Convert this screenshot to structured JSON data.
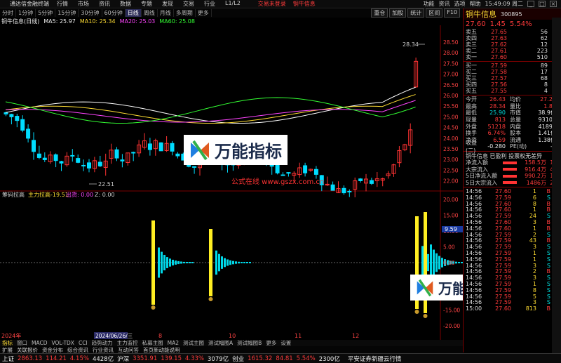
{
  "titlebar": {
    "app": "通达信金融终端",
    "menu": [
      "行情",
      "市场",
      "资讯",
      "数据",
      "专题",
      "发现",
      "交易",
      "行业",
      "L1/L2"
    ],
    "center_left": "交易未登录",
    "center_right": "铜牛信息",
    "right_menu": [
      "功能",
      "资讯",
      "选项",
      "帮助"
    ],
    "clock": "15:49:09 周二"
  },
  "toolbar": {
    "periods": [
      "分时",
      "1分钟",
      "5分钟",
      "15分钟",
      "30分钟",
      "60分钟",
      "日线",
      "周线",
      "月线",
      "多周期",
      "更多"
    ],
    "active": "日线",
    "tools": [
      "重仓",
      "加股",
      "统计",
      "区间",
      "F10"
    ]
  },
  "ma": {
    "title": "铜牛信息(日线)",
    "ma5": "MA5: 25.97",
    "ma10": "MA10: 25.34",
    "ma20": "MA20: 25.03",
    "ma60": "MA60: 25.08"
  },
  "chart": {
    "high_label": "28.34",
    "low_label": "22.51",
    "y_labels": [
      "28.50",
      "28.00",
      "27.50",
      "27.00",
      "26.50",
      "26.00",
      "25.50",
      "25.00",
      "24.50",
      "24.00",
      "23.50",
      "23.00",
      "22.50",
      "22.00"
    ]
  },
  "indicator": {
    "title": "筹码拉高",
    "name": "主力拉高",
    "value": "-19.51",
    "chuhuo": "出货: 0.00",
    "z": "Z: 0.00",
    "y_labels": [
      "20.00",
      "15.00",
      "10.00",
      "5.00",
      "0.00",
      "-5.00",
      "-10.00",
      "-15.00",
      "-20.00"
    ],
    "mark": "9.59"
  },
  "axis": {
    "year": "2024年",
    "date": "2024/06/26/三",
    "marks": [
      "8",
      "10",
      "11",
      "12"
    ]
  },
  "watermark": {
    "text": "万能指标",
    "url": "公式在线 www.gszx.com.cn"
  },
  "quote": {
    "name": "铜牛信息",
    "price": "27.60",
    "change": "1.45",
    "pct": "5.54%",
    "code": "300895",
    "asks": [
      [
        "卖五",
        "27.65",
        "56"
      ],
      [
        "卖四",
        "27.63",
        "62"
      ],
      [
        "卖三",
        "27.62",
        "12"
      ],
      [
        "卖二",
        "27.61",
        "223"
      ],
      [
        "卖一",
        "27.60",
        "510"
      ]
    ],
    "bids": [
      [
        "买一",
        "27.59",
        "89"
      ],
      [
        "买二",
        "27.58",
        "17"
      ],
      [
        "买三",
        "27.57",
        "68"
      ],
      [
        "买四",
        "27.56",
        "8"
      ],
      [
        "买五",
        "27.55",
        "4"
      ]
    ],
    "stats": [
      [
        "今开",
        "26.43",
        "均价",
        "27.28"
      ],
      [
        "最高",
        "28.34",
        "量比",
        "1.88"
      ],
      [
        "最低",
        "25.90",
        "市值",
        "38.9亿"
      ],
      [
        "现量",
        "813",
        "总量",
        "93109"
      ],
      [
        "外盘",
        "51218",
        "内盘",
        "41891"
      ],
      [
        "换手",
        "6.74%",
        "股本",
        "1.41亿"
      ],
      [
        "净资",
        "6.59",
        "流通",
        "1.38亿"
      ],
      [
        "收益(二)",
        "-0.280",
        "PE(动)",
        "—"
      ]
    ],
    "tag": "铜牛信息 已盈利 投票权无差异",
    "flows": [
      [
        "净流入额",
        "158.5万",
        "1%"
      ],
      [
        "大宗流入",
        "916.4万",
        "4%"
      ],
      [
        "5日净流入额",
        "990.2万",
        "1%"
      ],
      [
        "5日大宗流入",
        "1486万",
        "2%"
      ]
    ],
    "ticks": [
      [
        "14:56",
        "27.60",
        "1",
        "B"
      ],
      [
        "14:56",
        "27.59",
        "6",
        "S"
      ],
      [
        "14:56",
        "27.60",
        "8",
        "B"
      ],
      [
        "14:56",
        "27.60",
        "1",
        "B"
      ],
      [
        "14:56",
        "27.59",
        "24",
        "S"
      ],
      [
        "14:56",
        "27.60",
        "3",
        "B"
      ],
      [
        "14:56",
        "27.60",
        "1",
        "B"
      ],
      [
        "14:56",
        "27.59",
        "2",
        "S"
      ],
      [
        "14:56",
        "27.59",
        "43",
        "B"
      ],
      [
        "14:56",
        "27.59",
        "3",
        "S"
      ],
      [
        "14:56",
        "27.59",
        "1",
        "S"
      ],
      [
        "14:56",
        "27.59",
        "1",
        "S"
      ],
      [
        "14:56",
        "27.59",
        "3",
        "S"
      ],
      [
        "14:56",
        "27.59",
        "2",
        "B"
      ],
      [
        "14:56",
        "27.59",
        "3",
        "S"
      ],
      [
        "14:56",
        "27.59",
        "1",
        "S"
      ],
      [
        "14:56",
        "27.59",
        "8",
        "S"
      ],
      [
        "14:56",
        "27.59",
        "5",
        "S"
      ],
      [
        "14:56",
        "27.59",
        "3",
        "S"
      ],
      [
        "15:00",
        "27.60",
        "813",
        "B"
      ]
    ]
  },
  "indbar": [
    "指标",
    "窗口",
    "MACD",
    "VOL-TDX",
    "CCI",
    "趋势动力",
    "主力监控",
    "私募主图",
    "MA2",
    "测试主图",
    "测试幅图A",
    "测试幅图B",
    "更多",
    "设置"
  ],
  "indbar2": [
    "扩展",
    "关联报价",
    "资金分布",
    "综合资讯",
    "行业资讯",
    "互动问答",
    "首页新动能说明"
  ],
  "status": {
    "sh_name": "上证",
    "sh_val": "2863.13",
    "sh_chg": "114.21",
    "sh_pct": "4.15%",
    "sh_amt": "4428亿",
    "sz_name": "沪深",
    "sz_val": "3351.91",
    "sz_chg": "139.15",
    "sz_pct": "4.33%",
    "sz_amt": "3079亿",
    "cy_name": "创业",
    "cy_val": "1615.32",
    "cy_chg": "84.81",
    "cy_pct": "5.54%",
    "cy_amt": "2300亿",
    "broker": "平安证券新疆云行情"
  }
}
